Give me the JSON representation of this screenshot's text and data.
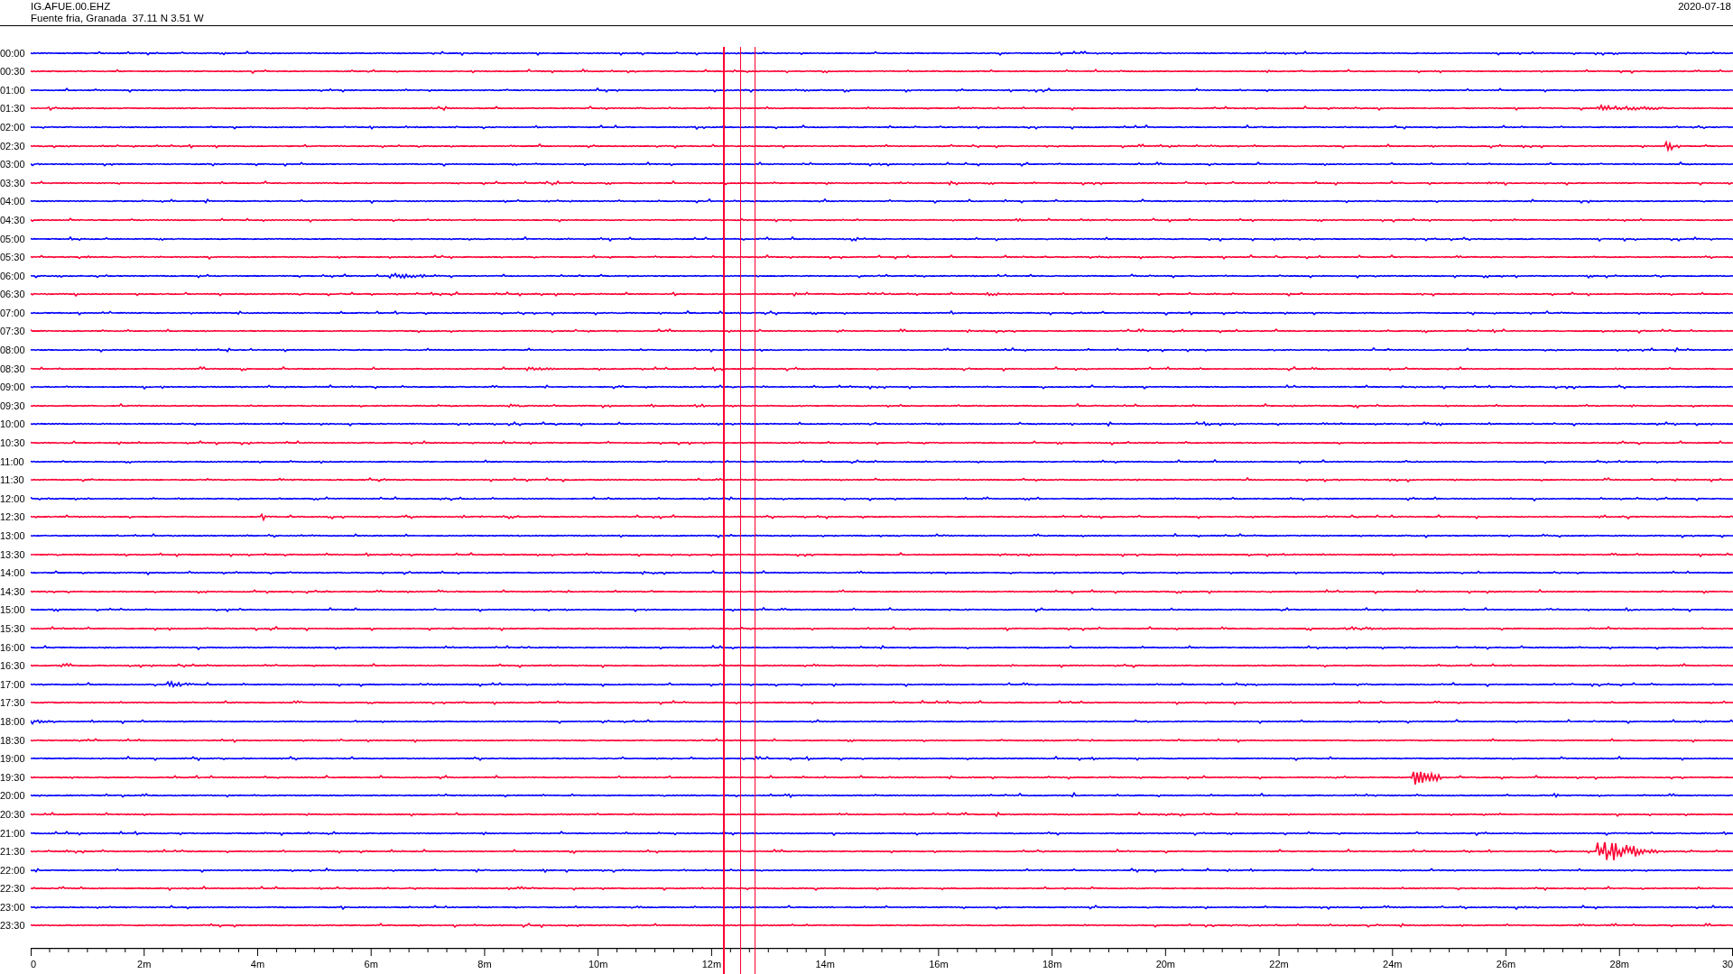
{
  "header": {
    "station": "IG.AFUE.00.EHZ",
    "location": "Fuente fria, Granada  37.11 N 3.51 W",
    "date": "2020-07-18"
  },
  "rows": [
    {
      "time": "00:00",
      "color": "#0000ff"
    },
    {
      "time": "00:30",
      "color": "#ff0033"
    },
    {
      "time": "01:00",
      "color": "#0000ff"
    },
    {
      "time": "01:30",
      "color": "#ff0033"
    },
    {
      "time": "02:00",
      "color": "#0000ff"
    },
    {
      "time": "02:30",
      "color": "#ff0033"
    },
    {
      "time": "03:00",
      "color": "#0000ff"
    },
    {
      "time": "03:30",
      "color": "#ff0033"
    },
    {
      "time": "04:00",
      "color": "#0000ff"
    },
    {
      "time": "04:30",
      "color": "#ff0033"
    },
    {
      "time": "05:00",
      "color": "#0000ff"
    },
    {
      "time": "05:30",
      "color": "#ff0033"
    },
    {
      "time": "06:00",
      "color": "#0000ff"
    },
    {
      "time": "06:30",
      "color": "#ff0033"
    },
    {
      "time": "07:00",
      "color": "#0000ff"
    },
    {
      "time": "07:30",
      "color": "#ff0033"
    },
    {
      "time": "08:00",
      "color": "#0000ff"
    },
    {
      "time": "08:30",
      "color": "#ff0033"
    },
    {
      "time": "09:00",
      "color": "#0000ff"
    },
    {
      "time": "09:30",
      "color": "#ff0033"
    },
    {
      "time": "10:00",
      "color": "#0000ff"
    },
    {
      "time": "10:30",
      "color": "#ff0033"
    },
    {
      "time": "11:00",
      "color": "#0000ff"
    },
    {
      "time": "11:30",
      "color": "#ff0033"
    },
    {
      "time": "12:00",
      "color": "#0000ff"
    },
    {
      "time": "12:30",
      "color": "#ff0033"
    },
    {
      "time": "13:00",
      "color": "#0000ff"
    },
    {
      "time": "13:30",
      "color": "#ff0033"
    },
    {
      "time": "14:00",
      "color": "#0000ff"
    },
    {
      "time": "14:30",
      "color": "#ff0033"
    },
    {
      "time": "15:00",
      "color": "#0000ff"
    },
    {
      "time": "15:30",
      "color": "#ff0033"
    },
    {
      "time": "16:00",
      "color": "#0000ff"
    },
    {
      "time": "16:30",
      "color": "#ff0033"
    },
    {
      "time": "17:00",
      "color": "#0000ff"
    },
    {
      "time": "17:30",
      "color": "#ff0033"
    },
    {
      "time": "18:00",
      "color": "#0000ff"
    },
    {
      "time": "18:30",
      "color": "#ff0033"
    },
    {
      "time": "19:00",
      "color": "#0000ff"
    },
    {
      "time": "19:30",
      "color": "#ff0033"
    },
    {
      "time": "20:00",
      "color": "#0000ff"
    },
    {
      "time": "20:30",
      "color": "#ff0033"
    },
    {
      "time": "21:00",
      "color": "#0000ff"
    },
    {
      "time": "21:30",
      "color": "#ff0033"
    },
    {
      "time": "22:00",
      "color": "#0000ff"
    },
    {
      "time": "22:30",
      "color": "#ff0033"
    },
    {
      "time": "23:00",
      "color": "#0000ff"
    },
    {
      "time": "23:30",
      "color": "#ff0033"
    }
  ],
  "x_axis": {
    "ticks": [
      "0",
      "2m",
      "4m",
      "6m",
      "8m",
      "10m",
      "12m",
      "14m",
      "16m",
      "18m",
      "20m",
      "22m",
      "24m",
      "26m",
      "28m",
      "30"
    ]
  }
}
